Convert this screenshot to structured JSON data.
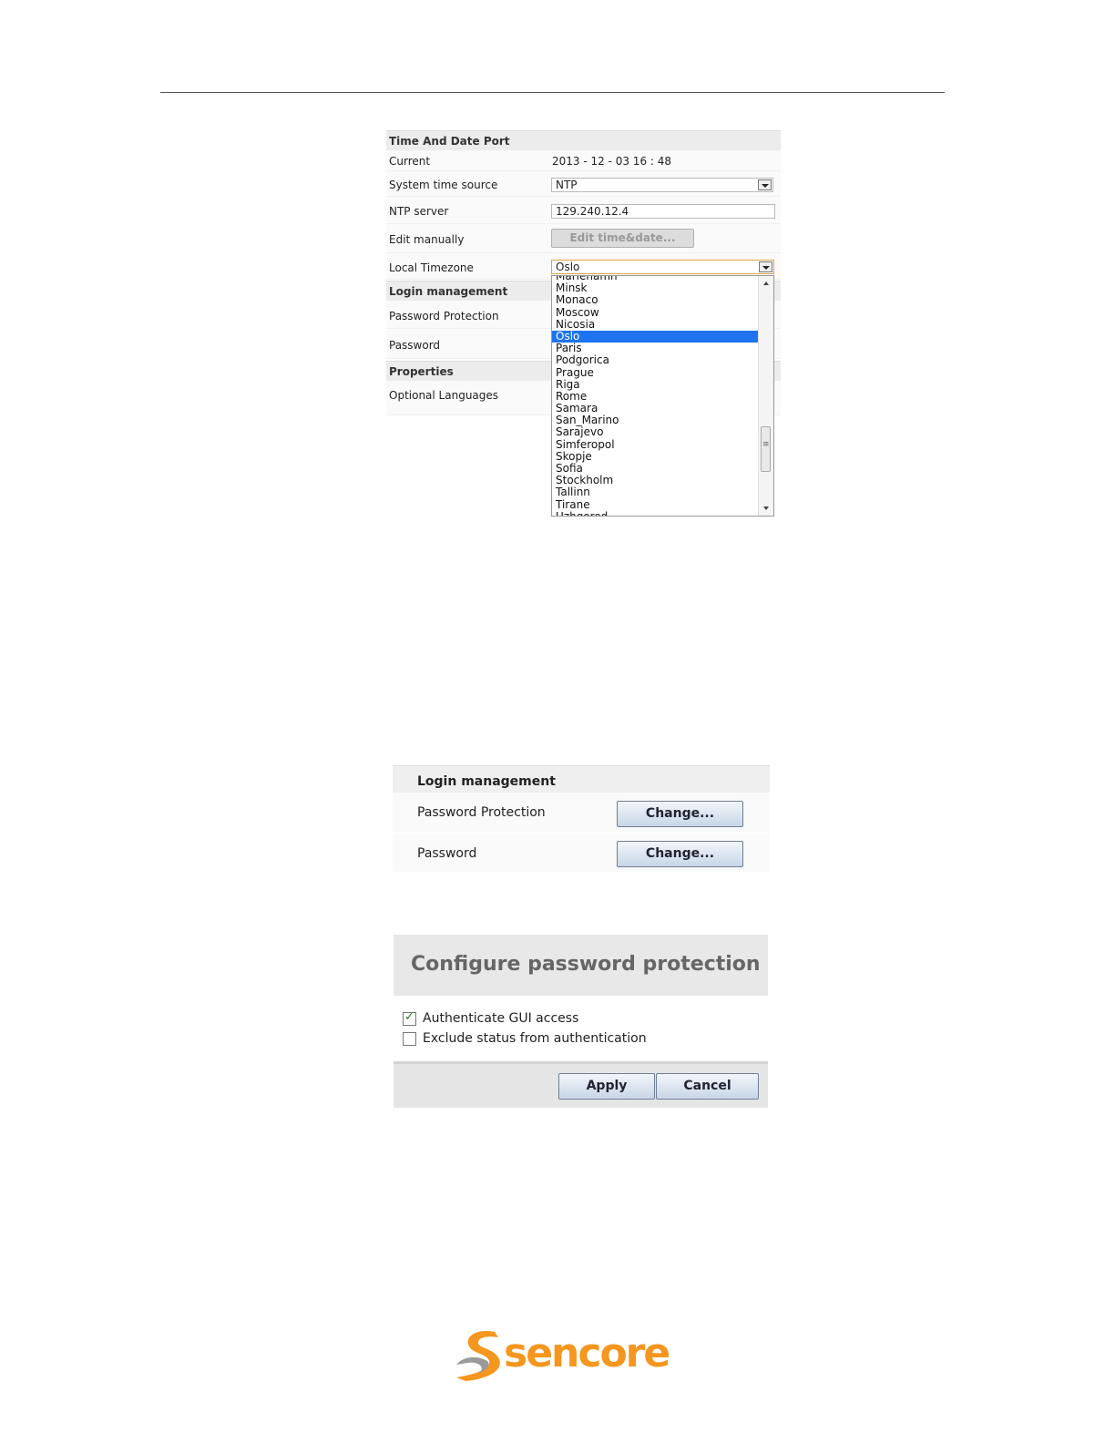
{
  "time_panel": {
    "header": "Time And Date Port",
    "current_label": "Current",
    "current_value": "2013 - 12 - 03  16 : 48",
    "source_label": "System time source",
    "source_value": "NTP",
    "ntp_label": "NTP server",
    "ntp_value": "129.240.12.4",
    "edit_label": "Edit manually",
    "edit_button": "Edit time&date...",
    "tz_label": "Local Timezone",
    "tz_value": "Oslo",
    "login_header": "Login management",
    "password_protection_label": "Password Protection",
    "password_label": "Password",
    "properties_header": "Properties",
    "languages_label": "Optional Languages",
    "timezone_options": [
      "Mariehamn",
      "Minsk",
      "Monaco",
      "Moscow",
      "Nicosia",
      "Oslo",
      "Paris",
      "Podgorica",
      "Prague",
      "Riga",
      "Rome",
      "Samara",
      "San_Marino",
      "Sarajevo",
      "Simferopol",
      "Skopje",
      "Sofia",
      "Stockholm",
      "Tallinn",
      "Tirane",
      "Uzhgorod"
    ],
    "selected_timezone": "Oslo"
  },
  "login_panel": {
    "header": "Login management",
    "password_protection_label": "Password Protection",
    "password_protection_button": "Change...",
    "password_label": "Password",
    "password_button": "Change..."
  },
  "password_dialog": {
    "title": "Configure password protection",
    "option1": "Authenticate GUI access",
    "option1_checked": true,
    "option2": "Exclude status from authentication",
    "option2_checked": false,
    "apply_button": "Apply",
    "cancel_button": "Cancel"
  },
  "logo": {
    "text": "sencore",
    "color": "#f5961e",
    "mark_color": "#9a9a9a"
  }
}
